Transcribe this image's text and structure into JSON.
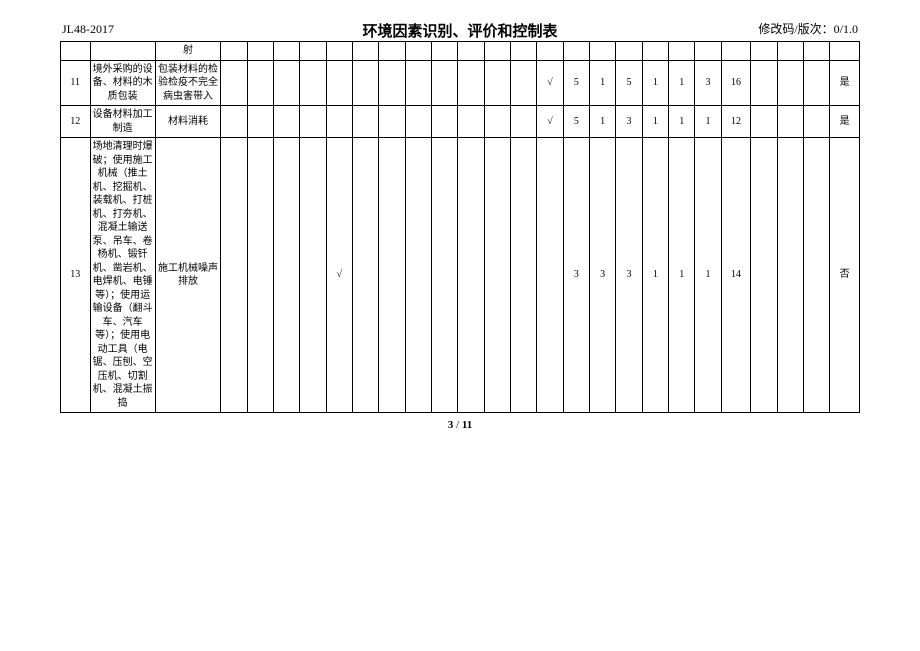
{
  "header": {
    "code": "JL48-2017",
    "title": "环境因素识别、评价和控制表",
    "rev_label": "修改码/版次：0/1.0"
  },
  "top_row": {
    "col3": "射"
  },
  "rows": [
    {
      "no": "11",
      "c2": "境外采购的设备、材料的木质包装",
      "c3": "包装材料的检验检疫不完全病虫害带入",
      "checks": [
        "",
        "",
        "",
        "",
        "",
        "",
        "",
        "",
        "",
        "",
        "",
        "",
        "√"
      ],
      "nums": [
        "5",
        "1",
        "5",
        "1",
        "1",
        "3",
        "16"
      ],
      "tail": [
        "",
        "",
        "",
        "是"
      ]
    },
    {
      "no": "12",
      "c2": "设备材料加工制造",
      "c3": "材料消耗",
      "checks": [
        "",
        "",
        "",
        "",
        "",
        "",
        "",
        "",
        "",
        "",
        "",
        "",
        "√"
      ],
      "nums": [
        "5",
        "1",
        "3",
        "1",
        "1",
        "1",
        "12"
      ],
      "tail": [
        "",
        "",
        "",
        "是"
      ]
    },
    {
      "no": "13",
      "c2": "场地清理时爆破；使用施工机械（推土机、挖掘机、装载机、打桩机、打夯机、混凝土输送泵、吊车、卷杨机、锻钎机、凿岩机、电焊机、电锤等）；使用运输设备（翻斗车、汽车等）；使用电动工具（电锯、压刨、空压机、切割机、混凝土振捣",
      "c3": "施工机械噪声排放",
      "checks": [
        "",
        "",
        "",
        "",
        "√",
        "",
        "",
        "",
        "",
        "",
        "",
        "",
        ""
      ],
      "nums": [
        "3",
        "3",
        "3",
        "1",
        "1",
        "1",
        "14"
      ],
      "tail": [
        "",
        "",
        "",
        "否"
      ]
    }
  ],
  "footer": {
    "page": "3",
    "total": "11"
  }
}
